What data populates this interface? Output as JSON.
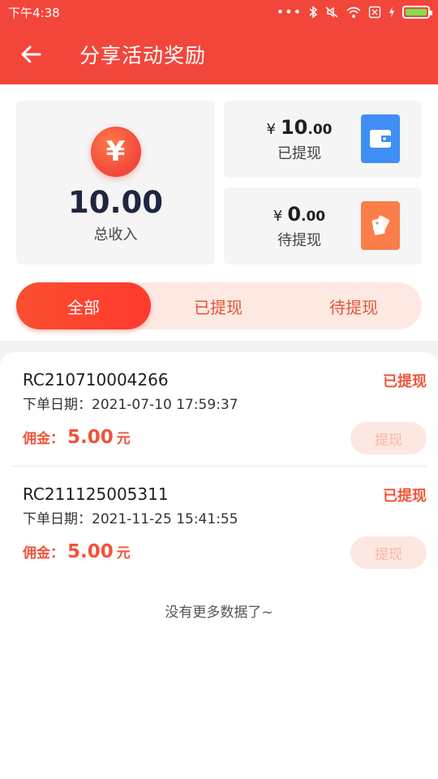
{
  "status_bar": {
    "time": "下午4:38",
    "dots": "•••"
  },
  "nav": {
    "title": "分享活动奖励"
  },
  "stats": {
    "currency_symbol": "¥",
    "total_value": "10.00",
    "total_label": "总收入",
    "withdrawn": {
      "currency": "¥",
      "int": "10",
      "dec": ".00",
      "label": "已提现"
    },
    "pending": {
      "currency": "¥",
      "int": "0",
      "dec": ".00",
      "label": "待提现"
    }
  },
  "tabs": [
    {
      "label": "全部",
      "active": true
    },
    {
      "label": "已提现",
      "active": false
    },
    {
      "label": "待提现",
      "active": false
    }
  ],
  "orders": [
    {
      "id": "RC210710004266",
      "status": "已提现",
      "date": "下单日期：2021-07-10 17:59:37",
      "commission_label": "佣金：",
      "commission_value": "5.00",
      "commission_unit": "元",
      "button": "提现"
    },
    {
      "id": "RC211125005311",
      "status": "已提现",
      "date": "下单日期：2021-11-25 15:41:55",
      "commission_label": "佣金：",
      "commission_value": "5.00",
      "commission_unit": "元",
      "button": "提现"
    }
  ],
  "footer": {
    "no_more": "没有更多数据了~"
  },
  "colors": {
    "brand": "#f2463b",
    "accent_orange": "#f0543a",
    "withdraw_icon": "#3f8ef5",
    "pending_icon": "#fb7e4a",
    "battery": "#7ee04a"
  }
}
